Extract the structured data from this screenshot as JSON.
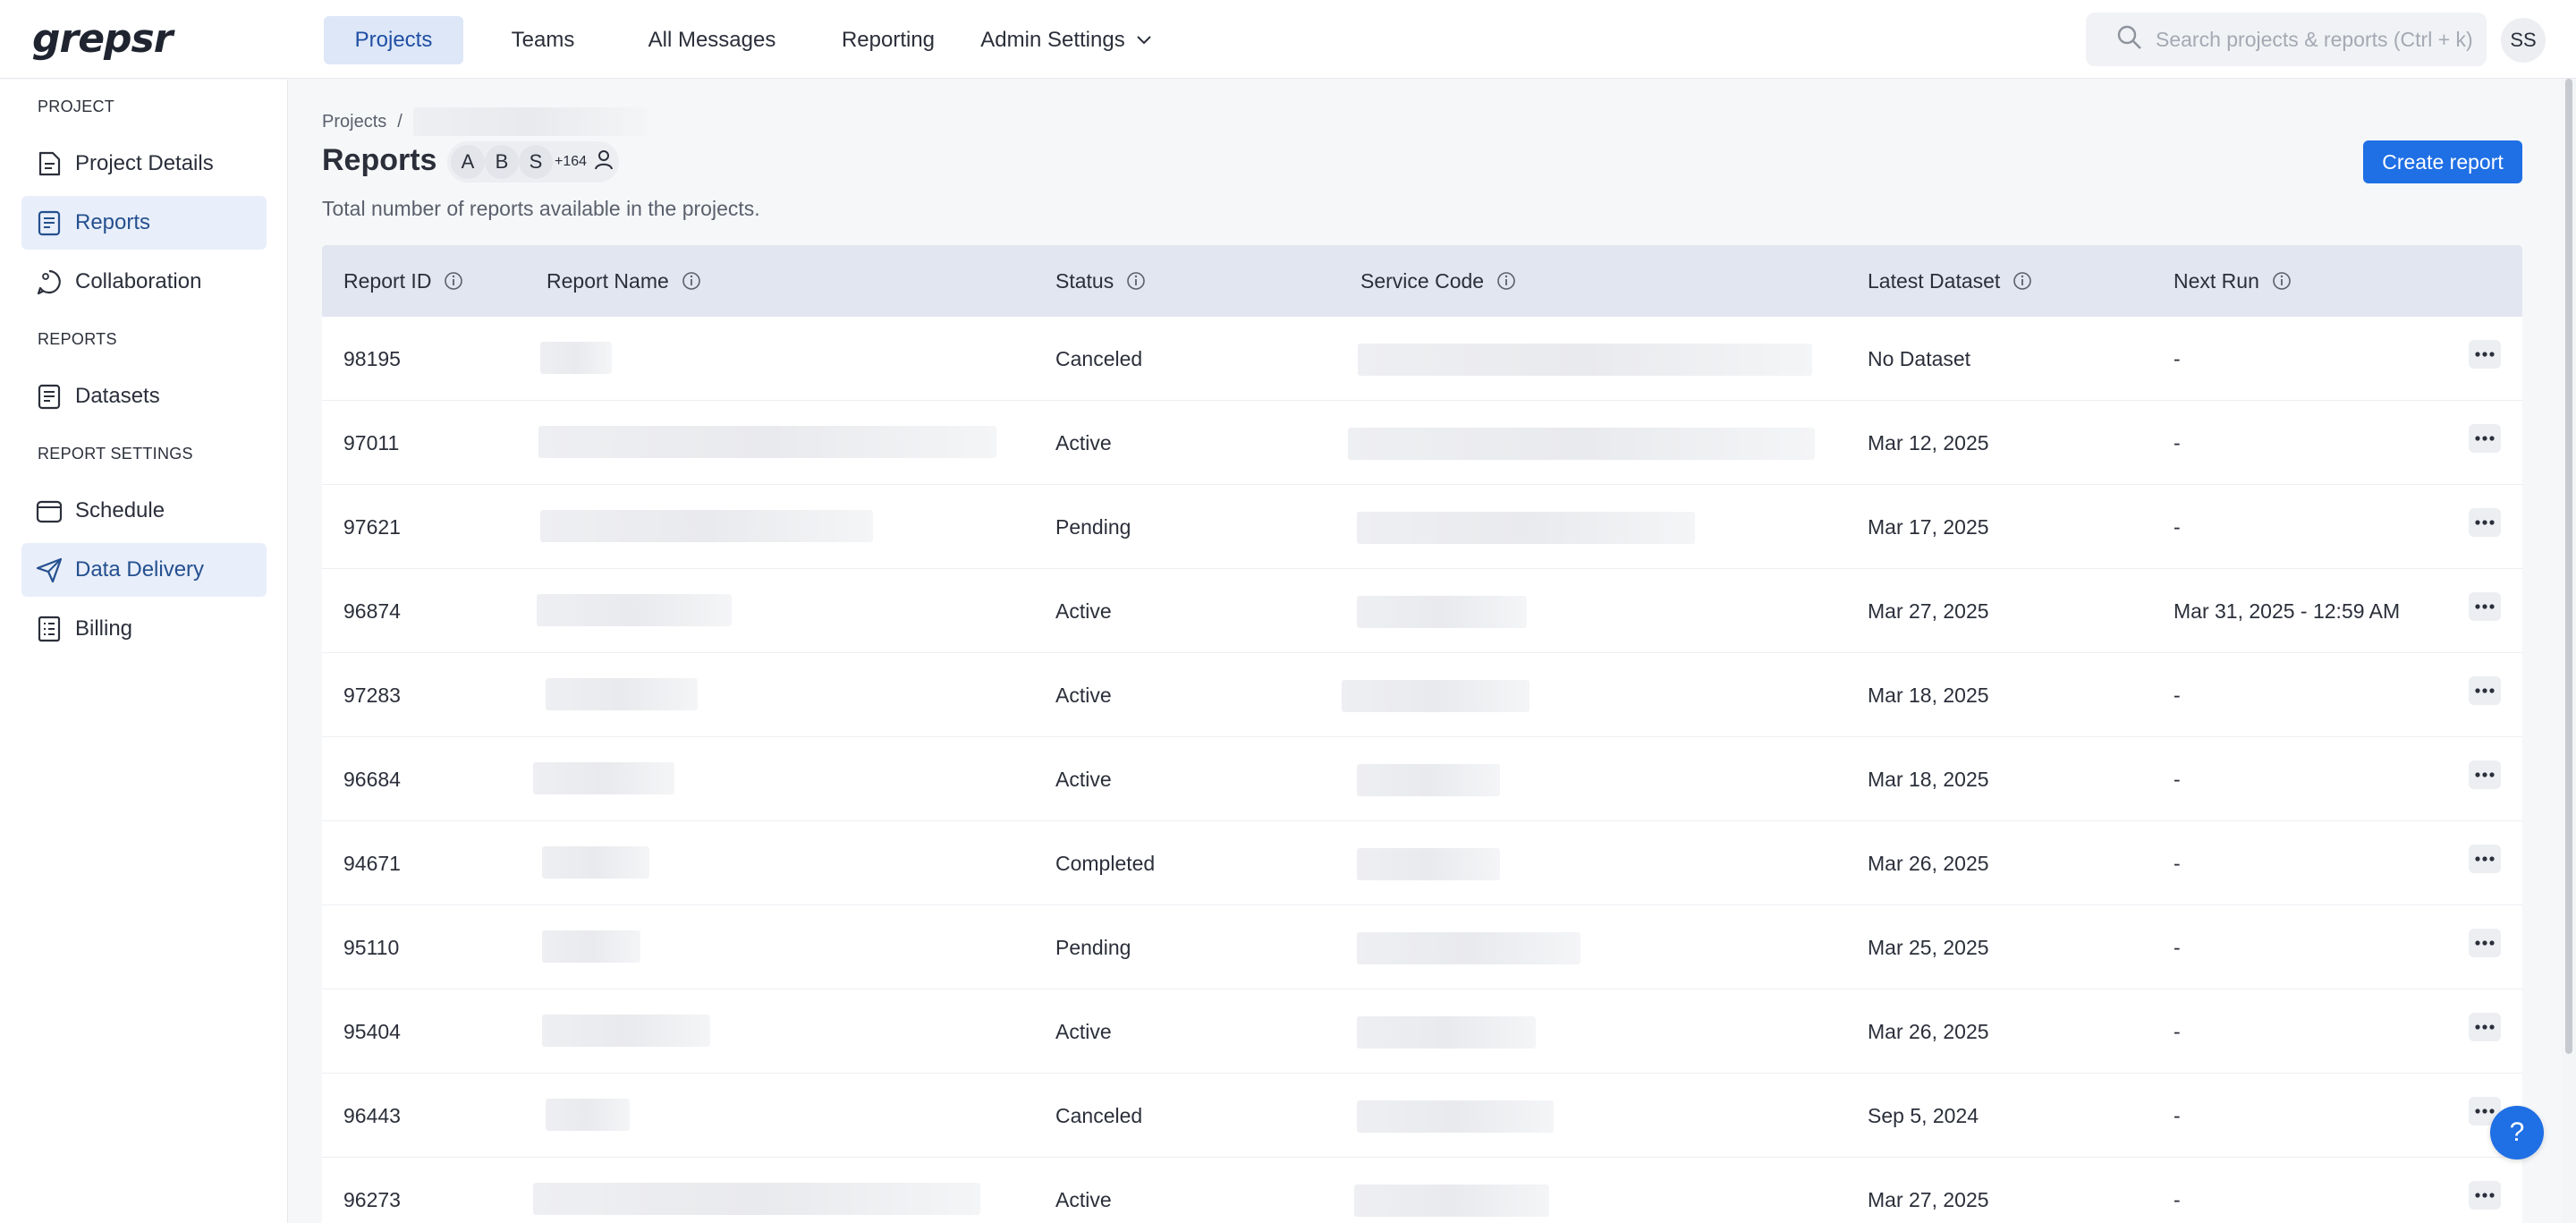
{
  "app": {
    "logo": "grepsr"
  },
  "nav": {
    "items": [
      {
        "label": "Projects",
        "active": true
      },
      {
        "label": "Teams"
      },
      {
        "label": "All Messages"
      },
      {
        "label": "Reporting"
      },
      {
        "label": "Admin Settings",
        "icon": "chevron-down-icon"
      }
    ]
  },
  "search": {
    "placeholder": "Search projects & reports (Ctrl + k)",
    "icon": "search-icon"
  },
  "user": {
    "initials": "SS"
  },
  "sidebar": {
    "project_heading": "PROJECT",
    "reports_heading": "REPORTS",
    "settings_heading": "REPORT SETTINGS",
    "items": [
      {
        "label": "Project Details",
        "icon": "project-details-icon"
      },
      {
        "label": "Reports",
        "icon": "reports-icon",
        "active": true
      },
      {
        "label": "Collaboration",
        "icon": "collaboration-icon"
      },
      {
        "label": "Datasets",
        "icon": "datasets-icon"
      },
      {
        "label": "Schedule",
        "icon": "schedule-icon"
      },
      {
        "label": "Data Delivery",
        "icon": "send-icon",
        "active": true
      },
      {
        "label": "Billing",
        "icon": "billing-icon"
      }
    ]
  },
  "breadcrumb": {
    "root": "Projects",
    "separator": "/"
  },
  "page": {
    "title": "Reports",
    "members": [
      "A",
      "B",
      "S"
    ],
    "members_more": "+164",
    "subtitle": "Total number of reports available in the projects.",
    "create_label": "Create report"
  },
  "table": {
    "headers": [
      "Report ID",
      "Report Name",
      "Status",
      "Service Code",
      "Latest Dataset",
      "Next Run"
    ],
    "rows": [
      {
        "id": "98195",
        "status": "Canceled",
        "latest": "No Dataset",
        "next": "-"
      },
      {
        "id": "97011",
        "status": "Active",
        "latest": "Mar 12, 2025",
        "next": "-"
      },
      {
        "id": "97621",
        "status": "Pending",
        "latest": "Mar 17, 2025",
        "next": "-"
      },
      {
        "id": "96874",
        "status": "Active",
        "latest": "Mar 27, 2025",
        "next": "Mar 31, 2025 - 12:59 AM"
      },
      {
        "id": "97283",
        "status": "Active",
        "latest": "Mar 18, 2025",
        "next": "-"
      },
      {
        "id": "96684",
        "status": "Active",
        "latest": "Mar 18, 2025",
        "next": "-"
      },
      {
        "id": "94671",
        "status": "Completed",
        "latest": "Mar 26, 2025",
        "next": "-"
      },
      {
        "id": "95110",
        "status": "Pending",
        "latest": "Mar 25, 2025",
        "next": "-"
      },
      {
        "id": "95404",
        "status": "Active",
        "latest": "Mar 26, 2025",
        "next": "-"
      },
      {
        "id": "96443",
        "status": "Canceled",
        "latest": "Sep 5, 2024",
        "next": "-"
      },
      {
        "id": "96273",
        "status": "Active",
        "latest": "Mar 27, 2025",
        "next": "-"
      }
    ]
  },
  "help": {
    "label": "?"
  },
  "colors": {
    "accent": "#1f6fe5",
    "header_bg": "#e1e6f1",
    "active_bg": "#e8eefa"
  }
}
